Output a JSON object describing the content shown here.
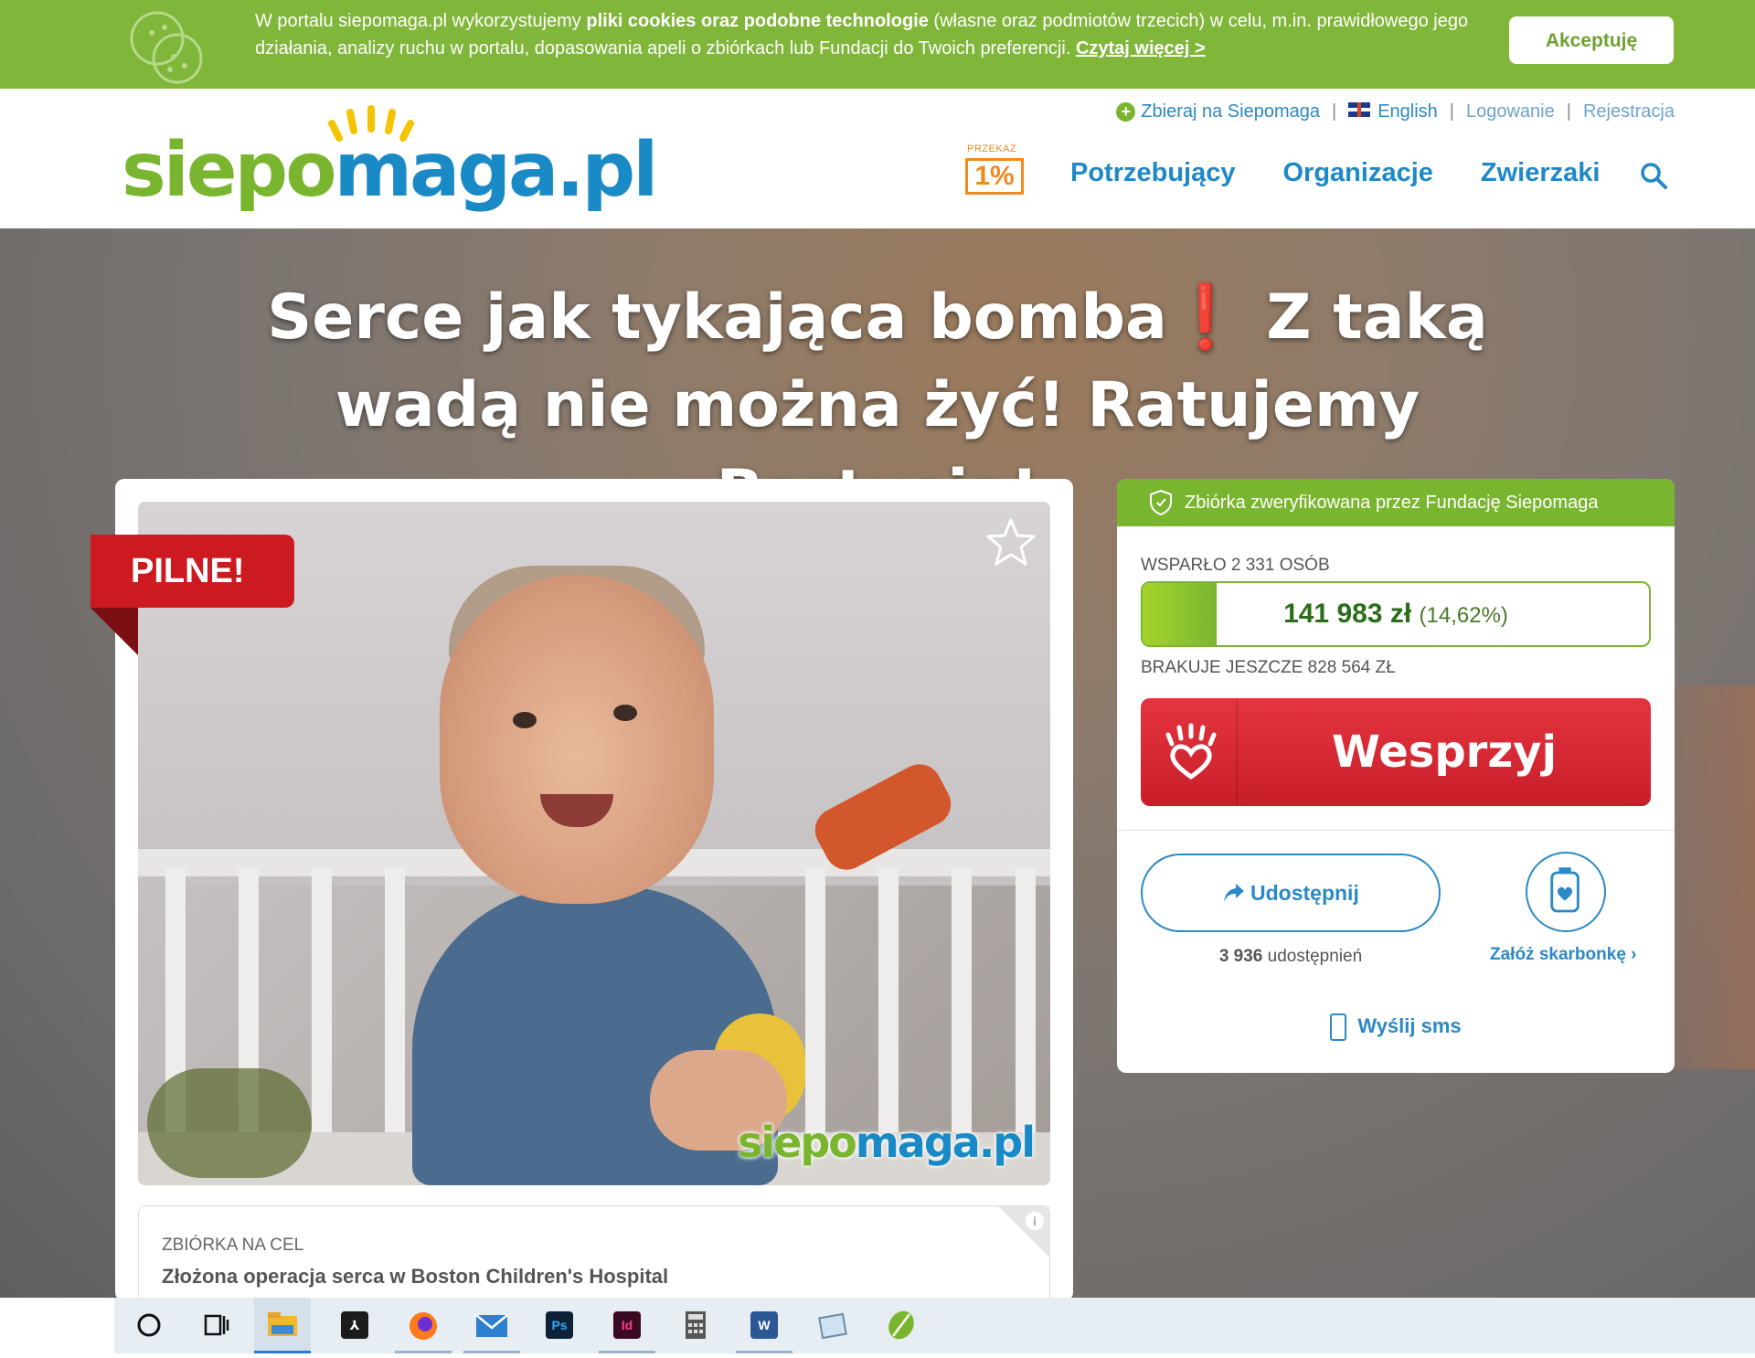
{
  "cookie_bar": {
    "text_1": "W portalu siepomaga.pl wykorzystujemy ",
    "text_bold": "pliki cookies oraz podobne technologie",
    "text_2": " (własne oraz podmiotów trzecich) w celu, m.in. prawidłowego jego działania, analizy ruchu w portalu, dopasowania apeli o zbiórkach lub Fundacji do Twoich preferencji. ",
    "read_more": "Czytaj więcej >",
    "accept_label": "Akceptuję",
    "icon": "cookie-icon"
  },
  "header": {
    "logo_part1": "siepo",
    "logo_part2": "maga.pl",
    "top_links": {
      "collect": "Zbieraj na Siepomaga",
      "english": "English",
      "login": "Logowanie",
      "register": "Rejestracja"
    },
    "one_percent_small": "PRZEKAŻ",
    "one_percent_big": "1%",
    "nav": [
      "Potrzebujący",
      "Organizacje",
      "Zwierzaki"
    ]
  },
  "hero": {
    "title_part1": "Serce jak tykająca bomba",
    "title_bang": "❗",
    "title_part2": " Z taką wadą nie można żyć! Ratujemy Bartusia!"
  },
  "campaign": {
    "badge": "PILNE!",
    "photo_logo_part1": "siepo",
    "photo_logo_part2": "maga.pl",
    "goal_label": "ZBIÓRKA NA CEL",
    "goal_text": "Złożona operacja serca w Boston Children's Hospital"
  },
  "donation": {
    "verified": "Zbiórka zweryfikowana przez Fundację Siepomaga",
    "supported": "WSPARŁO 2 331 OSÓB",
    "amount": "141 983 zł",
    "percent": "(14,62%)",
    "progress_fraction": 0.1462,
    "missing": "BRAKUJE JESZCZE 828 564 ZŁ",
    "support_label": "Wesprzyj",
    "share_label": "Udostępnij",
    "share_count": "3 936",
    "share_count_suffix": " udostępnień",
    "piggy_label": "Załóż skarbonkę ›",
    "sms_label": "Wyślij sms"
  },
  "colors": {
    "green": "#80b63a",
    "blue": "#1f88c7",
    "red": "#cc1a20",
    "orange": "#f08a1e"
  },
  "taskbar": {
    "icons": [
      "cortana-icon",
      "task-view-icon",
      "file-explorer-icon",
      "acrobat-icon",
      "firefox-icon",
      "mail-icon",
      "photoshop-icon",
      "indesign-icon",
      "calculator-icon",
      "word-icon",
      "notes-icon",
      "app-icon"
    ],
    "photoshop_label": "Ps",
    "indesign_label": "Id",
    "word_label": "W"
  }
}
